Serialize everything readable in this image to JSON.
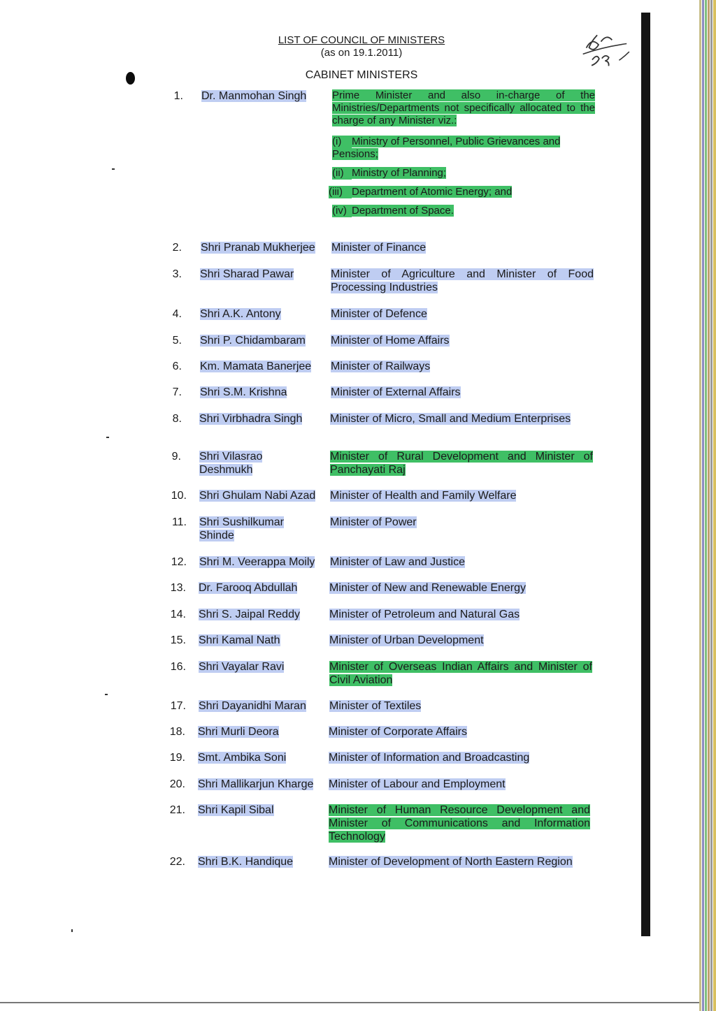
{
  "header": {
    "title": "LIST OF COUNCIL OF MINISTERS",
    "date_line": "(as on 19.1.2011)",
    "section": "CABINET MINISTERS",
    "handwritten_note": "dc 53"
  },
  "ministers": [
    {
      "num": "1.",
      "name": "Dr. Manmohan Singh",
      "portfolio": "Prime Minister and also in-charge of the Ministries/Departments not specifically allocated to the charge of any Minister viz.:",
      "sub": [
        {
          "num": "(i)",
          "text": "Ministry of Personnel, Public Grievances and Pensions;"
        },
        {
          "num": "(ii)",
          "text": "Ministry of Planning;"
        },
        {
          "num": "(iii)",
          "text": "Department of Atomic Energy; and"
        },
        {
          "num": "(iv)",
          "text": "Department of Space."
        }
      ]
    },
    {
      "num": "2.",
      "name": "Shri Pranab Mukherjee",
      "portfolio": "Minister of Finance"
    },
    {
      "num": "3.",
      "name": "Shri Sharad Pawar",
      "portfolio": "Minister of Agriculture and Minister of Food Processing Industries"
    },
    {
      "num": "4.",
      "name": "Shri A.K. Antony",
      "portfolio": "Minister of Defence"
    },
    {
      "num": "5.",
      "name": "Shri P. Chidambaram",
      "portfolio": "Minister of Home Affairs"
    },
    {
      "num": "6.",
      "name": "Km. Mamata Banerjee",
      "portfolio": "Minister of Railways"
    },
    {
      "num": "7.",
      "name": "Shri S.M. Krishna",
      "portfolio": "Minister of External Affairs"
    },
    {
      "num": "8.",
      "name": "Shri Virbhadra Singh",
      "portfolio": "Minister of Micro, Small and Medium Enterprises"
    },
    {
      "num": "9.",
      "name": "Shri Vilasrao Deshmukh",
      "portfolio": "Minister of Rural Development and Minister of Panchayati Raj"
    },
    {
      "num": "10.",
      "name": "Shri Ghulam Nabi Azad",
      "portfolio": "Minister of Health and Family Welfare"
    },
    {
      "num": "11.",
      "name": "Shri Sushilkumar Shinde",
      "portfolio": "Minister of Power"
    },
    {
      "num": "12.",
      "name": "Shri M. Veerappa Moily",
      "portfolio": "Minister of Law and Justice"
    },
    {
      "num": "13.",
      "name": "Dr. Farooq Abdullah",
      "portfolio": "Minister of New and Renewable Energy"
    },
    {
      "num": "14.",
      "name": "Shri S. Jaipal Reddy",
      "portfolio": "Minister of Petroleum and Natural Gas"
    },
    {
      "num": "15.",
      "name": "Shri Kamal Nath",
      "portfolio": "Minister of Urban Development"
    },
    {
      "num": "16.",
      "name": "Shri Vayalar Ravi",
      "portfolio": "Minister of Overseas Indian Affairs and Minister of Civil Aviation"
    },
    {
      "num": "17.",
      "name": "Shri Dayanidhi Maran",
      "portfolio": "Minister of Textiles"
    },
    {
      "num": "18.",
      "name": "Shri Murli Deora",
      "portfolio": "Minister of Corporate Affairs"
    },
    {
      "num": "19.",
      "name": "Smt. Ambika Soni",
      "portfolio": "Minister of Information and Broadcasting"
    },
    {
      "num": "20.",
      "name": "Shri Mallikarjun Kharge",
      "portfolio": "Minister of Labour and Employment"
    },
    {
      "num": "21.",
      "name": "Shri Kapil Sibal",
      "portfolio": "Minister of Human Resource Development and Minister of Communications and Information Technology"
    },
    {
      "num": "22.",
      "name": "Shri B.K. Handique",
      "portfolio": "Minister of Development of North Eastern Region"
    }
  ]
}
